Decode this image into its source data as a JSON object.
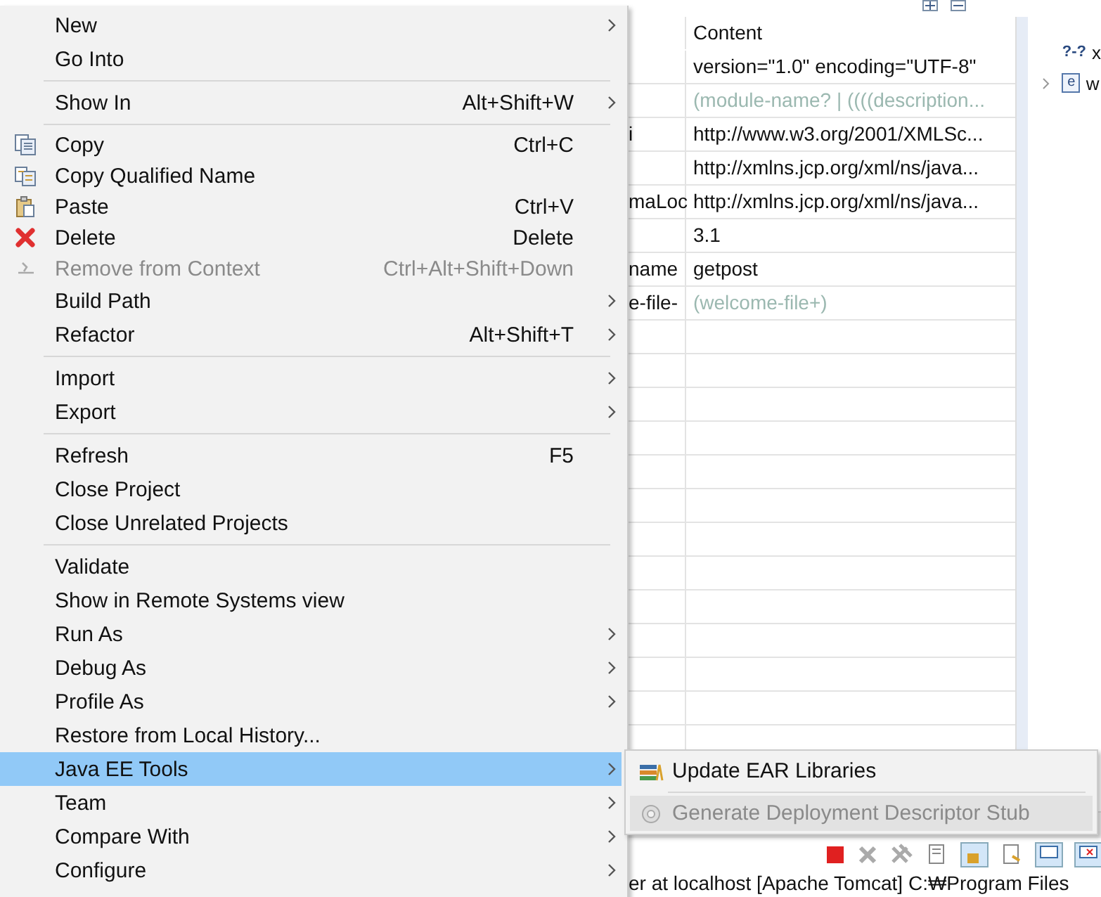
{
  "editor": {
    "header": "Content",
    "rows": [
      {
        "content": "version=\"1.0\" encoding=\"UTF-8\"",
        "greyed": false
      },
      {
        "content": "(module-name? | ((((description...",
        "greyed": true
      },
      {
        "node": "i",
        "content": "http://www.w3.org/2001/XMLSc...",
        "greyed": false
      },
      {
        "content": "http://xmlns.jcp.org/xml/ns/java...",
        "greyed": false
      },
      {
        "node": "maLoc",
        "content": "http://xmlns.jcp.org/xml/ns/java...",
        "greyed": false
      },
      {
        "content": "3.1",
        "greyed": false
      },
      {
        "node": "name",
        "content": "getpost",
        "greyed": false
      },
      {
        "node": "e-file-",
        "content": "(welcome-file+)",
        "greyed": true
      }
    ]
  },
  "outline": {
    "items": [
      {
        "marker": "?-?",
        "label": "x",
        "expandable": false
      },
      {
        "badge": "e",
        "label": "w",
        "expandable": true
      }
    ]
  },
  "console": {
    "line": "er at localhost [Apache Tomcat] C:₩Program Files"
  },
  "menu": {
    "groups": [
      [
        {
          "label": "New",
          "submenu": true,
          "disabled": false,
          "selected": false
        },
        {
          "label": "Go Into",
          "submenu": false,
          "disabled": false,
          "selected": false
        }
      ],
      [
        {
          "label": "Show In",
          "shortcut": "Alt+Shift+W",
          "submenu": true,
          "disabled": false,
          "selected": false
        }
      ],
      [
        {
          "label": "Copy",
          "kind": "copy",
          "shortcut": "Ctrl+C",
          "submenu": false,
          "disabled": false,
          "selected": false
        },
        {
          "label": "Copy Qualified Name",
          "kind": "qualified",
          "submenu": false,
          "disabled": false,
          "selected": false
        },
        {
          "label": "Paste",
          "kind": "paste",
          "shortcut": "Ctrl+V",
          "submenu": false,
          "disabled": false,
          "selected": false
        },
        {
          "label": "Delete",
          "kind": "delete",
          "shortcut": "Delete",
          "submenu": false,
          "disabled": false,
          "selected": false
        },
        {
          "label": "Remove from Context",
          "kind": "remove",
          "shortcut": "Ctrl+Alt+Shift+Down",
          "submenu": false,
          "disabled": true,
          "selected": false
        },
        {
          "label": "Build Path",
          "submenu": true,
          "disabled": false,
          "selected": false
        },
        {
          "label": "Refactor",
          "shortcut": "Alt+Shift+T",
          "submenu": true,
          "disabled": false,
          "selected": false
        }
      ],
      [
        {
          "label": "Import",
          "submenu": true,
          "disabled": false,
          "selected": false
        },
        {
          "label": "Export",
          "submenu": true,
          "disabled": false,
          "selected": false
        }
      ],
      [
        {
          "label": "Refresh",
          "shortcut": "F5",
          "submenu": false,
          "disabled": false,
          "selected": false
        },
        {
          "label": "Close Project",
          "submenu": false,
          "disabled": false,
          "selected": false
        },
        {
          "label": "Close Unrelated Projects",
          "submenu": false,
          "disabled": false,
          "selected": false
        }
      ],
      [
        {
          "label": "Validate",
          "submenu": false,
          "disabled": false,
          "selected": false
        },
        {
          "label": "Show in Remote Systems view",
          "submenu": false,
          "disabled": false,
          "selected": false
        },
        {
          "label": "Run As",
          "submenu": true,
          "disabled": false,
          "selected": false
        },
        {
          "label": "Debug As",
          "submenu": true,
          "disabled": false,
          "selected": false
        },
        {
          "label": "Profile As",
          "submenu": true,
          "disabled": false,
          "selected": false
        },
        {
          "label": "Restore from Local History...",
          "submenu": false,
          "disabled": false,
          "selected": false
        },
        {
          "label": "Java EE Tools",
          "submenu": true,
          "disabled": false,
          "selected": true
        },
        {
          "label": "Team",
          "submenu": true,
          "disabled": false,
          "selected": false
        },
        {
          "label": "Compare With",
          "submenu": true,
          "disabled": false,
          "selected": false
        },
        {
          "label": "Configure",
          "submenu": true,
          "disabled": false,
          "selected": false
        }
      ]
    ]
  },
  "submenu": {
    "groups": [
      [
        {
          "label": "Update EAR Libraries",
          "kind": "library",
          "disabled": false,
          "selected": false
        }
      ],
      [
        {
          "label": "Generate Deployment Descriptor Stub",
          "kind": "descriptor",
          "disabled": true,
          "selected": true
        }
      ]
    ]
  }
}
